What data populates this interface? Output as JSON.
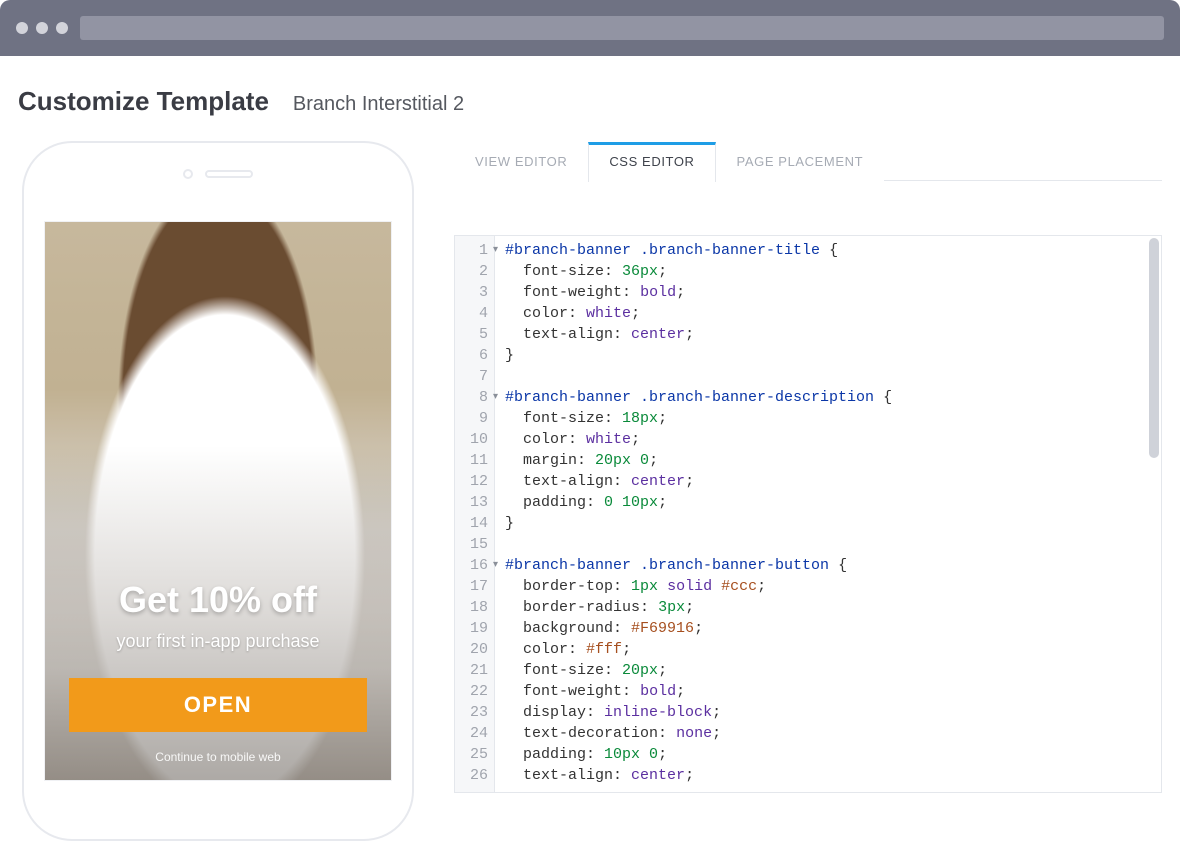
{
  "header": {
    "title": "Customize Template",
    "subtitle": "Branch Interstitial 2"
  },
  "tabs": {
    "view": "VIEW EDITOR",
    "css": "CSS EDITOR",
    "placement": "PAGE PLACEMENT",
    "active": "css"
  },
  "preview": {
    "headline": "Get 10% off",
    "subline": "your first in-app purchase",
    "button": "OPEN",
    "continue": "Continue to mobile web"
  },
  "css_lines": [
    {
      "n": 1,
      "fold": true,
      "tokens": [
        [
          "sel",
          "#branch-banner .branch-banner-title"
        ],
        [
          "p",
          " {"
        ]
      ]
    },
    {
      "n": 2,
      "tokens": [
        [
          "p",
          "  "
        ],
        [
          "prop",
          "font-size"
        ],
        [
          "p",
          ": "
        ],
        [
          "num",
          "36px"
        ],
        [
          "p",
          ";"
        ]
      ]
    },
    {
      "n": 3,
      "tokens": [
        [
          "p",
          "  "
        ],
        [
          "prop",
          "font-weight"
        ],
        [
          "p",
          ": "
        ],
        [
          "kw",
          "bold"
        ],
        [
          "p",
          ";"
        ]
      ]
    },
    {
      "n": 4,
      "tokens": [
        [
          "p",
          "  "
        ],
        [
          "prop",
          "color"
        ],
        [
          "p",
          ": "
        ],
        [
          "kw",
          "white"
        ],
        [
          "p",
          ";"
        ]
      ]
    },
    {
      "n": 5,
      "tokens": [
        [
          "p",
          "  "
        ],
        [
          "prop",
          "text-align"
        ],
        [
          "p",
          ": "
        ],
        [
          "kw",
          "center"
        ],
        [
          "p",
          ";"
        ]
      ]
    },
    {
      "n": 6,
      "tokens": [
        [
          "p",
          "}"
        ]
      ]
    },
    {
      "n": 7,
      "tokens": []
    },
    {
      "n": 8,
      "fold": true,
      "tokens": [
        [
          "sel",
          "#branch-banner .branch-banner-description"
        ],
        [
          "p",
          " {"
        ]
      ]
    },
    {
      "n": 9,
      "tokens": [
        [
          "p",
          "  "
        ],
        [
          "prop",
          "font-size"
        ],
        [
          "p",
          ": "
        ],
        [
          "num",
          "18px"
        ],
        [
          "p",
          ";"
        ]
      ]
    },
    {
      "n": 10,
      "tokens": [
        [
          "p",
          "  "
        ],
        [
          "prop",
          "color"
        ],
        [
          "p",
          ": "
        ],
        [
          "kw",
          "white"
        ],
        [
          "p",
          ";"
        ]
      ]
    },
    {
      "n": 11,
      "tokens": [
        [
          "p",
          "  "
        ],
        [
          "prop",
          "margin"
        ],
        [
          "p",
          ": "
        ],
        [
          "num",
          "20px 0"
        ],
        [
          "p",
          ";"
        ]
      ]
    },
    {
      "n": 12,
      "tokens": [
        [
          "p",
          "  "
        ],
        [
          "prop",
          "text-align"
        ],
        [
          "p",
          ": "
        ],
        [
          "kw",
          "center"
        ],
        [
          "p",
          ";"
        ]
      ]
    },
    {
      "n": 13,
      "tokens": [
        [
          "p",
          "  "
        ],
        [
          "prop",
          "padding"
        ],
        [
          "p",
          ": "
        ],
        [
          "num",
          "0 10px"
        ],
        [
          "p",
          ";"
        ]
      ]
    },
    {
      "n": 14,
      "tokens": [
        [
          "p",
          "}"
        ]
      ]
    },
    {
      "n": 15,
      "tokens": []
    },
    {
      "n": 16,
      "fold": true,
      "tokens": [
        [
          "sel",
          "#branch-banner .branch-banner-button"
        ],
        [
          "p",
          " {"
        ]
      ]
    },
    {
      "n": 17,
      "tokens": [
        [
          "p",
          "  "
        ],
        [
          "prop",
          "border-top"
        ],
        [
          "p",
          ": "
        ],
        [
          "num",
          "1px "
        ],
        [
          "kw",
          "solid "
        ],
        [
          "hex",
          "#ccc"
        ],
        [
          "p",
          ";"
        ]
      ]
    },
    {
      "n": 18,
      "tokens": [
        [
          "p",
          "  "
        ],
        [
          "prop",
          "border-radius"
        ],
        [
          "p",
          ": "
        ],
        [
          "num",
          "3px"
        ],
        [
          "p",
          ";"
        ]
      ]
    },
    {
      "n": 19,
      "tokens": [
        [
          "p",
          "  "
        ],
        [
          "prop",
          "background"
        ],
        [
          "p",
          ": "
        ],
        [
          "hex",
          "#F69916"
        ],
        [
          "p",
          ";"
        ]
      ]
    },
    {
      "n": 20,
      "tokens": [
        [
          "p",
          "  "
        ],
        [
          "prop",
          "color"
        ],
        [
          "p",
          ": "
        ],
        [
          "hex",
          "#fff"
        ],
        [
          "p",
          ";"
        ]
      ]
    },
    {
      "n": 21,
      "tokens": [
        [
          "p",
          "  "
        ],
        [
          "prop",
          "font-size"
        ],
        [
          "p",
          ": "
        ],
        [
          "num",
          "20px"
        ],
        [
          "p",
          ";"
        ]
      ]
    },
    {
      "n": 22,
      "tokens": [
        [
          "p",
          "  "
        ],
        [
          "prop",
          "font-weight"
        ],
        [
          "p",
          ": "
        ],
        [
          "kw",
          "bold"
        ],
        [
          "p",
          ";"
        ]
      ]
    },
    {
      "n": 23,
      "tokens": [
        [
          "p",
          "  "
        ],
        [
          "prop",
          "display"
        ],
        [
          "p",
          ": "
        ],
        [
          "kw",
          "inline-block"
        ],
        [
          "p",
          ";"
        ]
      ]
    },
    {
      "n": 24,
      "tokens": [
        [
          "p",
          "  "
        ],
        [
          "prop",
          "text-decoration"
        ],
        [
          "p",
          ": "
        ],
        [
          "kw",
          "none"
        ],
        [
          "p",
          ";"
        ]
      ]
    },
    {
      "n": 25,
      "tokens": [
        [
          "p",
          "  "
        ],
        [
          "prop",
          "padding"
        ],
        [
          "p",
          ": "
        ],
        [
          "num",
          "10px 0"
        ],
        [
          "p",
          ";"
        ]
      ]
    },
    {
      "n": 26,
      "tokens": [
        [
          "p",
          "  "
        ],
        [
          "prop",
          "text-align"
        ],
        [
          "p",
          ": "
        ],
        [
          "kw",
          "center"
        ],
        [
          "p",
          ";"
        ]
      ]
    }
  ]
}
